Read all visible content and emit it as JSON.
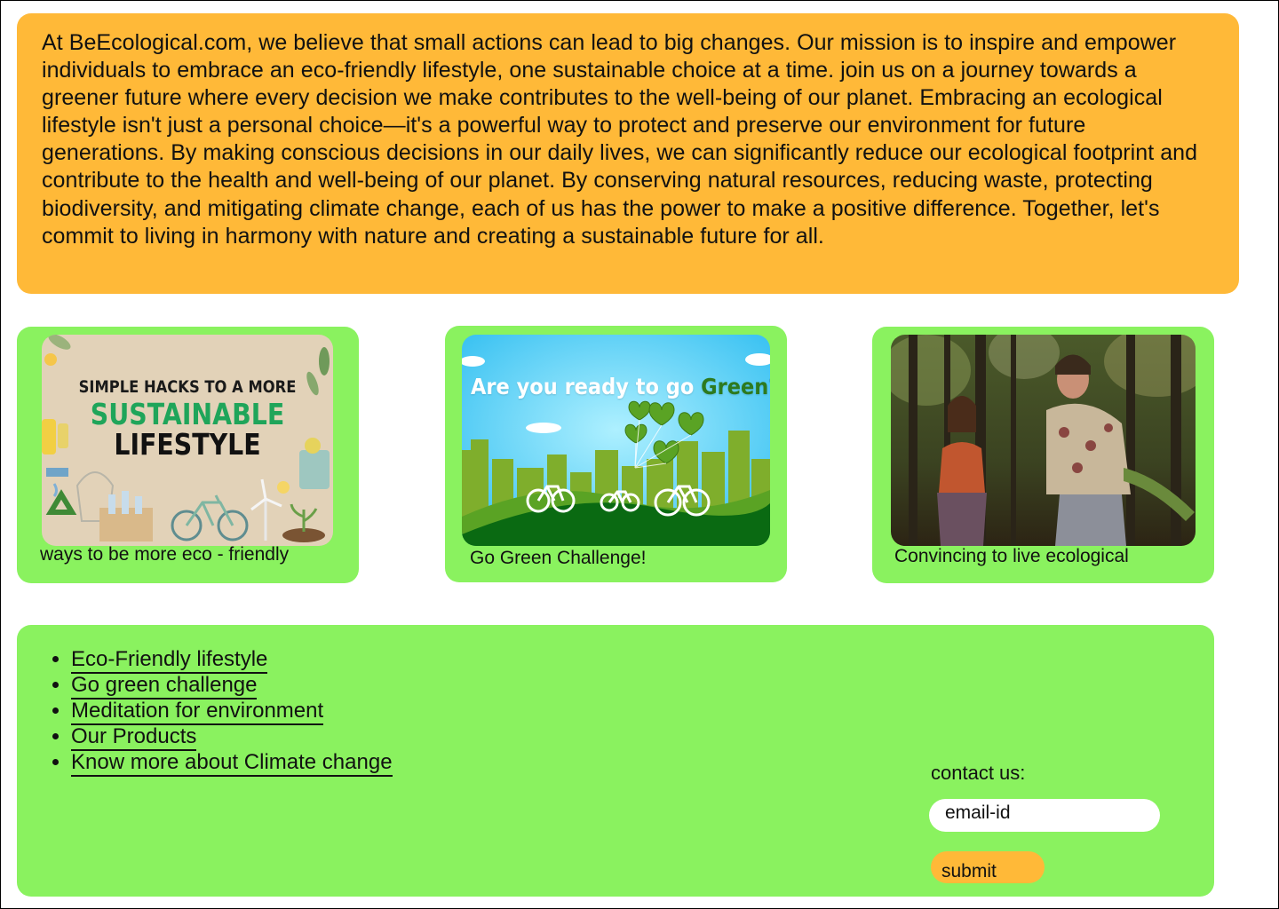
{
  "intro": {
    "text": "At BeEcological.com, we believe that small actions can lead to big changes. Our mission is to inspire and empower individuals to embrace an eco-friendly lifestyle, one sustainable choice at a time. join us on a journey towards a greener future where every decision we make contributes to the well-being of our planet. Embracing an ecological lifestyle isn't just a personal choice—it's a powerful way to protect and preserve our environment for future generations. By making conscious decisions in our daily lives, we can significantly reduce our ecological footprint and contribute to the health and well-being of our planet. By conserving natural resources, reducing waste, protecting biodiversity, and mitigating climate change, each of us has the power to make a positive difference. Together, let's commit to living in harmony with nature and creating a sustainable future for all."
  },
  "cards": [
    {
      "caption": "ways to be more eco - friendly",
      "image": {
        "line1": "SIMPLE HACKS TO A MORE",
        "line2": "SUSTAINABLE",
        "line3": "LIFESTYLE"
      }
    },
    {
      "caption": "Go Green Challenge!",
      "image": {
        "title": "Are you ready to go ",
        "title_highlight": "Green?"
      }
    },
    {
      "caption": "Convincing to live ecological"
    }
  ],
  "footer": {
    "links": [
      "Eco-Friendly lifestyle",
      "Go green challenge",
      "Meditation for environment",
      "Our Products",
      "Know more about Climate change"
    ],
    "contact_label": "contact us:",
    "email_placeholder": "email-id",
    "submit_label": "submit"
  },
  "colors": {
    "intro_bg": "#ffb938",
    "panel_bg": "#8af25f",
    "button_bg": "#ffb938"
  }
}
